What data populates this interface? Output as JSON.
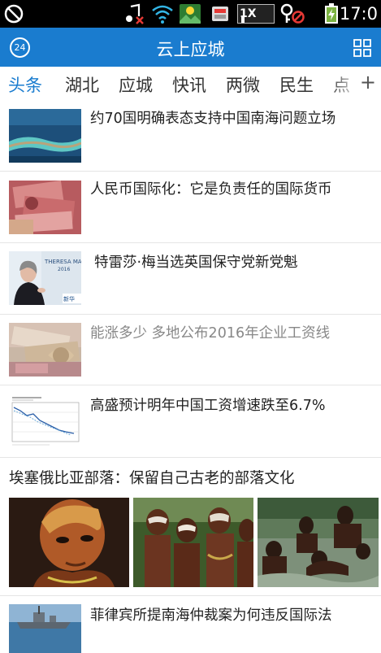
{
  "status_bar": {
    "time": "17:0",
    "icons": [
      "no-sync-icon",
      "music-mute-icon",
      "wifi-icon",
      "photo-notification-icon",
      "storage-icon",
      "network-1x-icon",
      "key-blocked-icon",
      "battery-charging-icon"
    ],
    "network_label": "1X"
  },
  "app_bar": {
    "title": "云上应城",
    "left_badge": "24",
    "right_icon": "grid-menu-icon",
    "color": "#1a7ccf"
  },
  "tabs": {
    "items": [
      "头条",
      "湖北",
      "应城",
      "快讯",
      "两微",
      "民生",
      "点"
    ],
    "active": "头条",
    "add_label": "+"
  },
  "news": [
    {
      "title": "约70国明确表态支持中国南海问题立场",
      "read": false
    },
    {
      "title": "人民币国际化：它是负责任的国际货币",
      "read": false
    },
    {
      "title": "特雷莎·梅当选英国保守党新党魁",
      "read": false
    },
    {
      "title": "能涨多少 多地公布2016年企业工资线",
      "read": true
    },
    {
      "title": "高盛预计明年中国工资增速跌至6.7%",
      "read": false
    }
  ],
  "gallery": {
    "title": "埃塞俄比亚部落：保留自己古老的部落文化"
  },
  "last_item": {
    "title": "菲律宾所提南海仲裁案为何违反国际法"
  },
  "thumb_texts": {
    "may_banner": "THERESA MA",
    "may_year": "2016",
    "may_logo": "新华"
  }
}
